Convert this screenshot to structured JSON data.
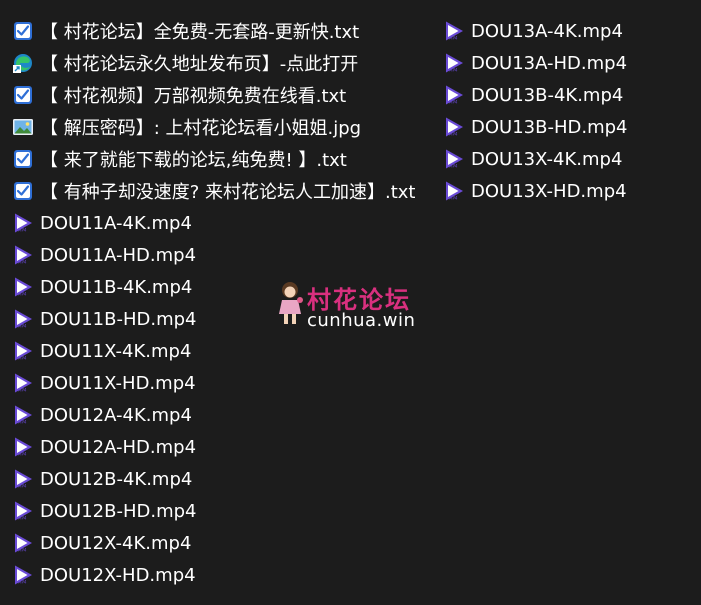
{
  "files_left": [
    {
      "name": "【 村花论坛】全免费-无套路-更新快.txt",
      "icon": "text-file-icon"
    },
    {
      "name": "【 村花论坛永久地址发布页】-点此打开",
      "icon": "edge-shortcut-icon"
    },
    {
      "name": "【 村花视频】万部视频免费在线看.txt",
      "icon": "text-file-icon"
    },
    {
      "name": "【 解压密码】: 上村花论坛看小姐姐.jpg",
      "icon": "image-file-icon"
    },
    {
      "name": "【 来了就能下载的论坛,纯免费! 】.txt",
      "icon": "text-file-icon"
    },
    {
      "name": "【 有种子却没速度? 来村花论坛人工加速】.txt",
      "icon": "text-file-icon"
    },
    {
      "name": "DOU11A-4K.mp4",
      "icon": "video-file-icon"
    },
    {
      "name": "DOU11A-HD.mp4",
      "icon": "video-file-icon"
    },
    {
      "name": "DOU11B-4K.mp4",
      "icon": "video-file-icon"
    },
    {
      "name": "DOU11B-HD.mp4",
      "icon": "video-file-icon"
    },
    {
      "name": "DOU11X-4K.mp4",
      "icon": "video-file-icon"
    },
    {
      "name": "DOU11X-HD.mp4",
      "icon": "video-file-icon"
    },
    {
      "name": "DOU12A-4K.mp4",
      "icon": "video-file-icon"
    },
    {
      "name": "DOU12A-HD.mp4",
      "icon": "video-file-icon"
    },
    {
      "name": "DOU12B-4K.mp4",
      "icon": "video-file-icon"
    },
    {
      "name": "DOU12B-HD.mp4",
      "icon": "video-file-icon"
    },
    {
      "name": "DOU12X-4K.mp4",
      "icon": "video-file-icon"
    },
    {
      "name": "DOU12X-HD.mp4",
      "icon": "video-file-icon"
    }
  ],
  "files_right": [
    {
      "name": "DOU13A-4K.mp4",
      "icon": "video-file-icon"
    },
    {
      "name": "DOU13A-HD.mp4",
      "icon": "video-file-icon"
    },
    {
      "name": "DOU13B-4K.mp4",
      "icon": "video-file-icon"
    },
    {
      "name": "DOU13B-HD.mp4",
      "icon": "video-file-icon"
    },
    {
      "name": "DOU13X-4K.mp4",
      "icon": "video-file-icon"
    },
    {
      "name": "DOU13X-HD.mp4",
      "icon": "video-file-icon"
    }
  ],
  "watermark": {
    "title": "村花论坛",
    "url": "cunhua.win"
  },
  "colors": {
    "background": "#1c1c1c",
    "text": "#ffffff",
    "video_icon": "#6a4bd6",
    "watermark_title": "#d9307f"
  }
}
